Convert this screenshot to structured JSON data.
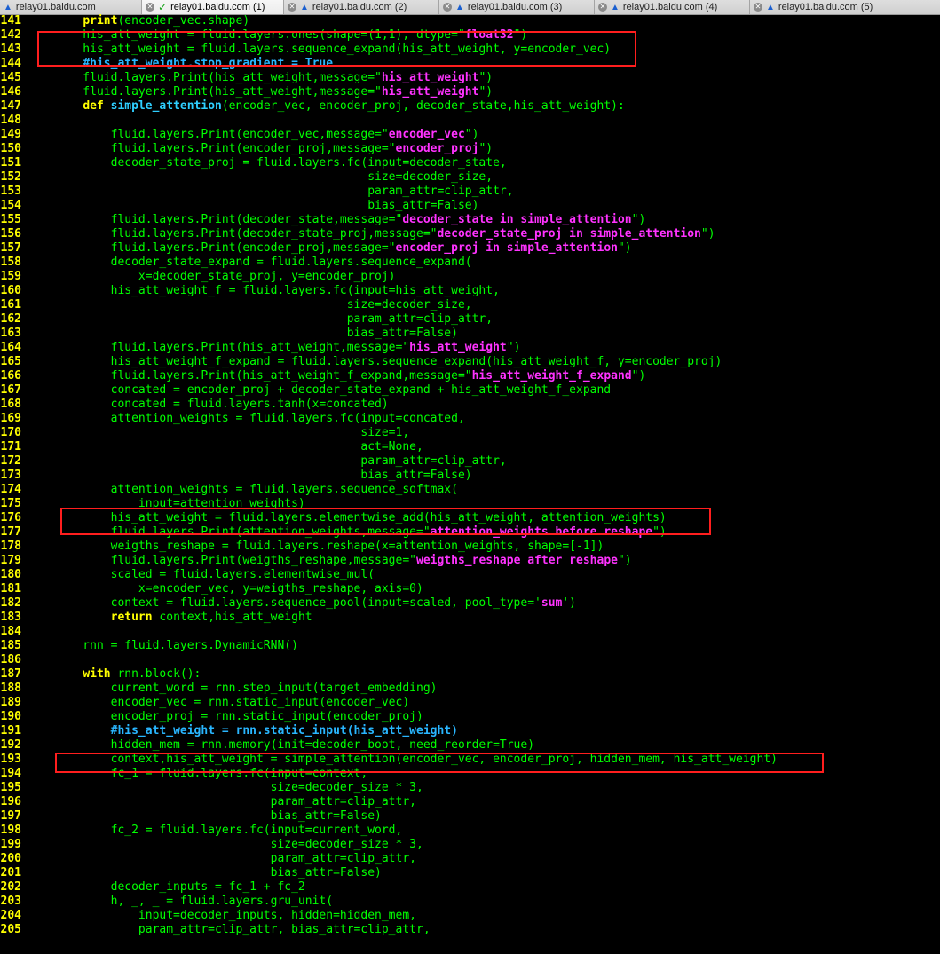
{
  "tabs": [
    {
      "label": "relay01.baidu.com",
      "status": "warning-icon",
      "active": false
    },
    {
      "label": "relay01.baidu.com (1)",
      "status": "check-icon",
      "active": true
    },
    {
      "label": "relay01.baidu.com (2)",
      "status": "warning-icon",
      "active": false
    },
    {
      "label": "relay01.baidu.com (3)",
      "status": "warning-icon",
      "active": false
    },
    {
      "label": "relay01.baidu.com (4)",
      "status": "warning-icon",
      "active": false
    },
    {
      "label": "relay01.baidu.com (5)",
      "status": "warning-icon",
      "active": false
    }
  ],
  "colors": {
    "background": "#000000",
    "line_number": "#ffff00",
    "code_default": "#00ff00",
    "keyword": "#ffff00",
    "function_name": "#2ecfff",
    "string": "#ff33ff",
    "comment": "#29b6ff",
    "highlight_box": "#ff1e1e"
  },
  "code_lines": [
    {
      "n": "141",
      "segs": [
        {
          "t": "    "
        },
        {
          "t": "print",
          "c": "kw"
        },
        {
          "t": "(encoder_vec.shape)"
        }
      ]
    },
    {
      "n": "142",
      "segs": [
        {
          "t": "    his_att_weight = fluid.layers.ones(shape=(1,1), dtype=\""
        },
        {
          "t": "float32",
          "c": "str"
        },
        {
          "t": "\")"
        }
      ]
    },
    {
      "n": "143",
      "segs": [
        {
          "t": "    his_att_weight = fluid.layers.sequence_expand(his_att_weight, y=encoder_vec)"
        }
      ]
    },
    {
      "n": "144",
      "segs": [
        {
          "t": "    "
        },
        {
          "t": "#his_att_weight.stop_gradient = True",
          "c": "cm"
        }
      ]
    },
    {
      "n": "145",
      "segs": [
        {
          "t": "    fluid.layers.Print(his_att_weight,message=\""
        },
        {
          "t": "his_att_weight",
          "c": "str"
        },
        {
          "t": "\")"
        }
      ]
    },
    {
      "n": "146",
      "segs": [
        {
          "t": "    fluid.layers.Print(his_att_weight,message=\""
        },
        {
          "t": "his_att_weight",
          "c": "str"
        },
        {
          "t": "\")"
        }
      ]
    },
    {
      "n": "147",
      "segs": [
        {
          "t": "    "
        },
        {
          "t": "def",
          "c": "kw"
        },
        {
          "t": " "
        },
        {
          "t": "simple_attention",
          "c": "fn"
        },
        {
          "t": "(encoder_vec, encoder_proj, decoder_state,his_att_weight):"
        }
      ]
    },
    {
      "n": "148",
      "segs": [
        {
          "t": ""
        }
      ]
    },
    {
      "n": "149",
      "segs": [
        {
          "t": "        fluid.layers.Print(encoder_vec,message=\""
        },
        {
          "t": "encoder_vec",
          "c": "str"
        },
        {
          "t": "\")"
        }
      ]
    },
    {
      "n": "150",
      "segs": [
        {
          "t": "        fluid.layers.Print(encoder_proj,message=\""
        },
        {
          "t": "encoder_proj",
          "c": "str"
        },
        {
          "t": "\")"
        }
      ]
    },
    {
      "n": "151",
      "segs": [
        {
          "t": "        decoder_state_proj = fluid.layers.fc(input=decoder_state,"
        }
      ]
    },
    {
      "n": "152",
      "segs": [
        {
          "t": "                                             size=decoder_size,"
        }
      ]
    },
    {
      "n": "153",
      "segs": [
        {
          "t": "                                             param_attr=clip_attr,"
        }
      ]
    },
    {
      "n": "154",
      "segs": [
        {
          "t": "                                             bias_attr=False)"
        }
      ]
    },
    {
      "n": "155",
      "segs": [
        {
          "t": "        fluid.layers.Print(decoder_state,message=\""
        },
        {
          "t": "decoder_state in simple_attention",
          "c": "str"
        },
        {
          "t": "\")"
        }
      ]
    },
    {
      "n": "156",
      "segs": [
        {
          "t": "        fluid.layers.Print(decoder_state_proj,message=\""
        },
        {
          "t": "decoder_state_proj in simple_attention",
          "c": "str"
        },
        {
          "t": "\")"
        }
      ]
    },
    {
      "n": "157",
      "segs": [
        {
          "t": "        fluid.layers.Print(encoder_proj,message=\""
        },
        {
          "t": "encoder_proj in simple_attention",
          "c": "str"
        },
        {
          "t": "\")"
        }
      ]
    },
    {
      "n": "158",
      "segs": [
        {
          "t": "        decoder_state_expand = fluid.layers.sequence_expand("
        }
      ]
    },
    {
      "n": "159",
      "segs": [
        {
          "t": "            x=decoder_state_proj, y=encoder_proj)"
        }
      ]
    },
    {
      "n": "160",
      "segs": [
        {
          "t": "        his_att_weight_f = fluid.layers.fc(input=his_att_weight,"
        }
      ]
    },
    {
      "n": "161",
      "segs": [
        {
          "t": "                                          size=decoder_size,"
        }
      ]
    },
    {
      "n": "162",
      "segs": [
        {
          "t": "                                          param_attr=clip_attr,"
        }
      ]
    },
    {
      "n": "163",
      "segs": [
        {
          "t": "                                          bias_attr=False)"
        }
      ]
    },
    {
      "n": "164",
      "segs": [
        {
          "t": "        fluid.layers.Print(his_att_weight,message=\""
        },
        {
          "t": "his_att_weight",
          "c": "str"
        },
        {
          "t": "\")"
        }
      ]
    },
    {
      "n": "165",
      "segs": [
        {
          "t": "        his_att_weight_f_expand = fluid.layers.sequence_expand(his_att_weight_f, y=encoder_proj)"
        }
      ]
    },
    {
      "n": "166",
      "segs": [
        {
          "t": "        fluid.layers.Print(his_att_weight_f_expand,message=\""
        },
        {
          "t": "his_att_weight_f_expand",
          "c": "str"
        },
        {
          "t": "\")"
        }
      ]
    },
    {
      "n": "167",
      "segs": [
        {
          "t": "        concated = encoder_proj + decoder_state_expand + his_att_weight_f_expand"
        }
      ]
    },
    {
      "n": "168",
      "segs": [
        {
          "t": "        concated = fluid.layers.tanh(x=concated)"
        }
      ]
    },
    {
      "n": "169",
      "segs": [
        {
          "t": "        attention_weights = fluid.layers.fc(input=concated,"
        }
      ]
    },
    {
      "n": "170",
      "segs": [
        {
          "t": "                                            size=1,"
        }
      ]
    },
    {
      "n": "171",
      "segs": [
        {
          "t": "                                            act=None,"
        }
      ]
    },
    {
      "n": "172",
      "segs": [
        {
          "t": "                                            param_attr=clip_attr,"
        }
      ]
    },
    {
      "n": "173",
      "segs": [
        {
          "t": "                                            bias_attr=False)"
        }
      ]
    },
    {
      "n": "174",
      "segs": [
        {
          "t": "        attention_weights = fluid.layers.sequence_softmax("
        }
      ]
    },
    {
      "n": "175",
      "segs": [
        {
          "t": "            input=attention_weights)"
        }
      ]
    },
    {
      "n": "176",
      "segs": [
        {
          "t": "        his_att_weight = fluid.layers.elementwise_add(his_att_weight, attention_weights)"
        }
      ]
    },
    {
      "n": "177",
      "segs": [
        {
          "t": "        fluid.layers.Print(attention_weights,message=\""
        },
        {
          "t": "attention_weights before reshape",
          "c": "str"
        },
        {
          "t": "\")"
        }
      ]
    },
    {
      "n": "178",
      "segs": [
        {
          "t": "        weigths_reshape = fluid.layers.reshape(x=attention_weights, shape=[-1])"
        }
      ]
    },
    {
      "n": "179",
      "segs": [
        {
          "t": "        fluid.layers.Print(weigths_reshape,message=\""
        },
        {
          "t": "weigths_reshape after reshape",
          "c": "str"
        },
        {
          "t": "\")"
        }
      ]
    },
    {
      "n": "180",
      "segs": [
        {
          "t": "        scaled = fluid.layers.elementwise_mul("
        }
      ]
    },
    {
      "n": "181",
      "segs": [
        {
          "t": "            x=encoder_vec, y=weigths_reshape, axis=0)"
        }
      ]
    },
    {
      "n": "182",
      "segs": [
        {
          "t": "        context = fluid.layers.sequence_pool(input=scaled, pool_type='"
        },
        {
          "t": "sum",
          "c": "str"
        },
        {
          "t": "')"
        }
      ]
    },
    {
      "n": "183",
      "segs": [
        {
          "t": "        "
        },
        {
          "t": "return",
          "c": "kw"
        },
        {
          "t": " context,his_att_weight"
        }
      ]
    },
    {
      "n": "184",
      "segs": [
        {
          "t": ""
        }
      ]
    },
    {
      "n": "185",
      "segs": [
        {
          "t": "    rnn = fluid.layers.DynamicRNN()"
        }
      ]
    },
    {
      "n": "186",
      "segs": [
        {
          "t": ""
        }
      ]
    },
    {
      "n": "187",
      "segs": [
        {
          "t": "    "
        },
        {
          "t": "with",
          "c": "kw"
        },
        {
          "t": " rnn.block():"
        }
      ]
    },
    {
      "n": "188",
      "segs": [
        {
          "t": "        current_word = rnn.step_input(target_embedding)"
        }
      ]
    },
    {
      "n": "189",
      "segs": [
        {
          "t": "        encoder_vec = rnn.static_input(encoder_vec)"
        }
      ]
    },
    {
      "n": "190",
      "segs": [
        {
          "t": "        encoder_proj = rnn.static_input(encoder_proj)"
        }
      ]
    },
    {
      "n": "191",
      "segs": [
        {
          "t": "        "
        },
        {
          "t": "#his_att_weight = rnn.static_input(his_att_weight)",
          "c": "cm"
        }
      ]
    },
    {
      "n": "192",
      "segs": [
        {
          "t": "        hidden_mem = rnn.memory(init=decoder_boot, need_reorder=True)"
        }
      ]
    },
    {
      "n": "193",
      "segs": [
        {
          "t": "        context,his_att_weight = simple_attention(encoder_vec, encoder_proj, hidden_mem, his_att_weight)"
        }
      ]
    },
    {
      "n": "194",
      "segs": [
        {
          "t": "        fc_1 = fluid.layers.fc(input=context,"
        }
      ]
    },
    {
      "n": "195",
      "segs": [
        {
          "t": "                               size=decoder_size * 3,"
        }
      ]
    },
    {
      "n": "196",
      "segs": [
        {
          "t": "                               param_attr=clip_attr,"
        }
      ]
    },
    {
      "n": "197",
      "segs": [
        {
          "t": "                               bias_attr=False)"
        }
      ]
    },
    {
      "n": "198",
      "segs": [
        {
          "t": "        fc_2 = fluid.layers.fc(input=current_word,"
        }
      ]
    },
    {
      "n": "199",
      "segs": [
        {
          "t": "                               size=decoder_size * 3,"
        }
      ]
    },
    {
      "n": "200",
      "segs": [
        {
          "t": "                               param_attr=clip_attr,"
        }
      ]
    },
    {
      "n": "201",
      "segs": [
        {
          "t": "                               bias_attr=False)"
        }
      ]
    },
    {
      "n": "202",
      "segs": [
        {
          "t": "        decoder_inputs = fc_1 + fc_2"
        }
      ]
    },
    {
      "n": "203",
      "segs": [
        {
          "t": "        h, _, _ = fluid.layers.gru_unit("
        }
      ]
    },
    {
      "n": "204",
      "segs": [
        {
          "t": "            input=decoder_inputs, hidden=hidden_mem,"
        }
      ]
    },
    {
      "n": "205",
      "segs": [
        {
          "t": "            param_attr=clip_attr, bias_attr=clip_attr,"
        }
      ]
    }
  ]
}
